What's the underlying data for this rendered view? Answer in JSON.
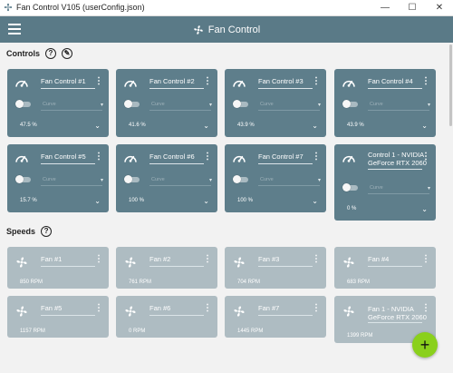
{
  "window": {
    "title": "Fan Control V105 (userConfig.json)",
    "minimize": "—",
    "maximize": "☐",
    "close": "✕"
  },
  "appbar": {
    "title": "Fan Control"
  },
  "controls_section": {
    "label": "Controls",
    "help": "?"
  },
  "speeds_section": {
    "label": "Speeds",
    "help": "?"
  },
  "controls": [
    {
      "name": "Fan Control #1",
      "mode": "Curve",
      "percent": "47.5 %"
    },
    {
      "name": "Fan Control #2",
      "mode": "Curve",
      "percent": "41.6 %"
    },
    {
      "name": "Fan Control #3",
      "mode": "Curve",
      "percent": "43.9 %"
    },
    {
      "name": "Fan Control #4",
      "mode": "Curve",
      "percent": "43.9 %"
    },
    {
      "name": "Fan Control #5",
      "mode": "Curve",
      "percent": "15.7 %"
    },
    {
      "name": "Fan Control #6",
      "mode": "Curve",
      "percent": "100 %"
    },
    {
      "name": "Fan Control #7",
      "mode": "Curve",
      "percent": "100 %"
    },
    {
      "name": "Control 1 - NVIDIA GeForce RTX 2060",
      "mode": "Curve",
      "percent": "0 %"
    }
  ],
  "speeds": [
    {
      "name": "Fan #1",
      "rpm": "850 RPM"
    },
    {
      "name": "Fan #2",
      "rpm": "761 RPM"
    },
    {
      "name": "Fan #3",
      "rpm": "704 RPM"
    },
    {
      "name": "Fan #4",
      "rpm": "683 RPM"
    },
    {
      "name": "Fan #5",
      "rpm": "1157 RPM"
    },
    {
      "name": "Fan #6",
      "rpm": "0 RPM"
    },
    {
      "name": "Fan #7",
      "rpm": "1445 RPM"
    },
    {
      "name": "Fan 1 - NVIDIA GeForce RTX 2060",
      "rpm": "1399 RPM"
    }
  ],
  "fab": {
    "label": "+"
  },
  "colors": {
    "appbar": "#5a7a87",
    "control_card": "#5e7e8b",
    "speed_card": "#aebcc2",
    "fab": "#8ad01c"
  }
}
